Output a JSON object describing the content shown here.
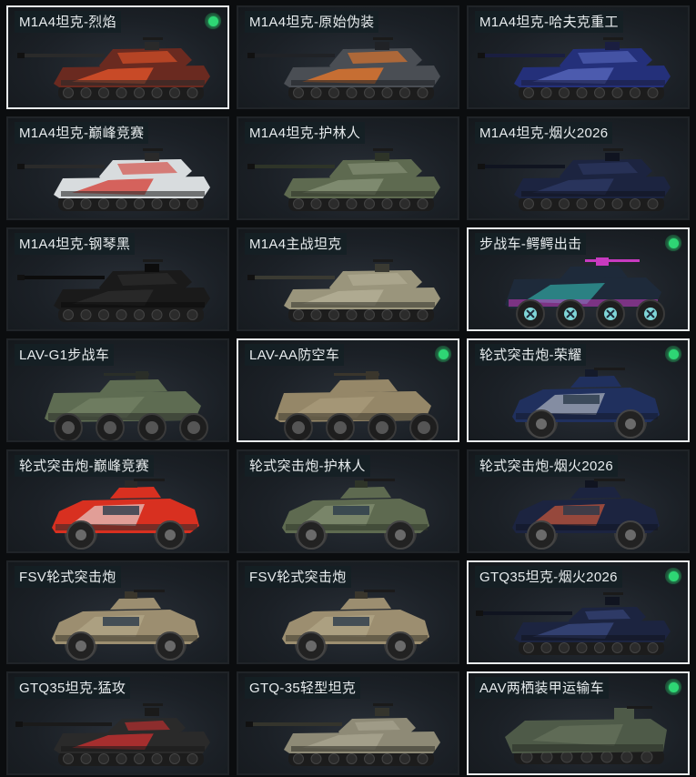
{
  "vehicles": [
    {
      "name": "M1A4坦克-烈焰",
      "kind": "tank",
      "owned": true,
      "selected": true,
      "colors": [
        "#6a2a20",
        "#e8562a",
        "#2a2a2a"
      ]
    },
    {
      "name": "M1A4坦克-原始伪装",
      "kind": "tank",
      "owned": false,
      "selected": false,
      "colors": [
        "#4a4e54",
        "#f07a28",
        "#202226"
      ]
    },
    {
      "name": "M1A4坦克-哈夫克重工",
      "kind": "tank",
      "owned": false,
      "selected": false,
      "colors": [
        "#24307a",
        "#5a6ac0",
        "#1a1e40"
      ]
    },
    {
      "name": "M1A4坦克-巅峰竞赛",
      "kind": "tank",
      "owned": false,
      "selected": false,
      "colors": [
        "#d8dcde",
        "#d43a30",
        "#2a2a2a"
      ]
    },
    {
      "name": "M1A4坦克-护林人",
      "kind": "tank",
      "owned": false,
      "selected": false,
      "colors": [
        "#5e6a50",
        "#8a957a",
        "#2e3428"
      ]
    },
    {
      "name": "M1A4坦克-烟火2026",
      "kind": "tank",
      "owned": false,
      "selected": false,
      "colors": [
        "#1c2440",
        "#2e3a66",
        "#101420"
      ]
    },
    {
      "name": "M1A4坦克-钢琴黑",
      "kind": "tank",
      "owned": false,
      "selected": false,
      "colors": [
        "#1a1a1a",
        "#2e2e2e",
        "#0c0c0c"
      ]
    },
    {
      "name": "M1A4主战坦克",
      "kind": "tank",
      "owned": false,
      "selected": false,
      "colors": [
        "#9a957c",
        "#b6b198",
        "#3a3a32"
      ]
    },
    {
      "name": "步战车-鳄鳄出击",
      "kind": "ifv",
      "owned": true,
      "selected": true,
      "colors": [
        "#1e2a3a",
        "#36c8c0",
        "#c83ac0"
      ]
    },
    {
      "name": "LAV-G1步战车",
      "kind": "lav",
      "owned": false,
      "selected": false,
      "colors": [
        "#5e6c52",
        "#7c8a6c",
        "#2a2e28"
      ]
    },
    {
      "name": "LAV-AA防空车",
      "kind": "lav",
      "owned": true,
      "selected": true,
      "colors": [
        "#958768",
        "#b0a282",
        "#3a362c"
      ]
    },
    {
      "name": "轮式突击炮-荣耀",
      "kind": "armored",
      "owned": true,
      "selected": true,
      "colors": [
        "#20305e",
        "#c8ccd0",
        "#141a2a"
      ]
    },
    {
      "name": "轮式突击炮-巅峰竞赛",
      "kind": "armored",
      "owned": false,
      "selected": false,
      "colors": [
        "#d83020",
        "#e8e8e8",
        "#2a2a2a"
      ]
    },
    {
      "name": "轮式突击炮-护林人",
      "kind": "armored",
      "owned": false,
      "selected": false,
      "colors": [
        "#5e6a50",
        "#8c987a",
        "#2e3428"
      ]
    },
    {
      "name": "轮式突击炮-烟火2026",
      "kind": "armored",
      "owned": false,
      "selected": false,
      "colors": [
        "#1c2440",
        "#e8603a",
        "#101420"
      ]
    },
    {
      "name": "FSV轮式突击炮",
      "kind": "armored",
      "owned": false,
      "selected": false,
      "colors": [
        "#9c8e70",
        "#b8ab8c",
        "#3a362c"
      ]
    },
    {
      "name": "FSV轮式突击炮",
      "kind": "armored",
      "owned": false,
      "selected": false,
      "colors": [
        "#9c8e70",
        "#b8ab8c",
        "#3a362c"
      ]
    },
    {
      "name": "GTQ35坦克-烟火2026",
      "kind": "lighttank",
      "owned": true,
      "selected": true,
      "colors": [
        "#1c2440",
        "#3a4a80",
        "#101420"
      ]
    },
    {
      "name": "GTQ35坦克-猛攻",
      "kind": "lighttank",
      "owned": false,
      "selected": false,
      "colors": [
        "#2a2a2a",
        "#d03030",
        "#1a1a1a"
      ]
    },
    {
      "name": "GTQ-35轻型坦克",
      "kind": "lighttank",
      "owned": false,
      "selected": false,
      "colors": [
        "#8e8a76",
        "#aaa692",
        "#34342c"
      ]
    },
    {
      "name": "AAV两栖装甲运输车",
      "kind": "aav",
      "owned": true,
      "selected": true,
      "colors": [
        "#4e5a48",
        "#6a7660",
        "#262c24"
      ]
    }
  ],
  "icons": {
    "owned": "owned-dot-icon"
  }
}
